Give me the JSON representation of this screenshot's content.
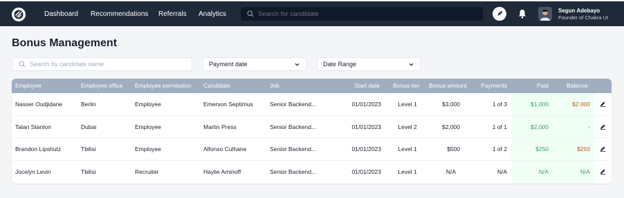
{
  "nav": {
    "items": [
      "Dashboard",
      "Recommendations",
      "Referrals",
      "Analytics"
    ],
    "search_placeholder": "Search for candidate"
  },
  "user": {
    "name": "Segun Adebayo",
    "role": "Founder of Chakra UI"
  },
  "page": {
    "title": "Bonus Management",
    "search_placeholder": "Search by candidate name",
    "filter_payment": "Payment date",
    "filter_range": "Date Range"
  },
  "table": {
    "headers": [
      "Employee",
      "Employee office",
      "Employee permission",
      "Candidate",
      "Job",
      "Start date",
      "Bonus tier",
      "Bonus amount",
      "Payments",
      "Paid",
      "Balance"
    ],
    "rows": [
      [
        "Nasser Oudjidane",
        "Berlin",
        "Employee",
        "Emerson Septimus",
        "Senior Backend...",
        "01/01/2023",
        "Level 1",
        "$3,000",
        "1 of 3",
        "$1,000",
        "$2 000"
      ],
      [
        "Talan Stanton",
        "Dubai",
        "Employee",
        "Martin Press",
        "Senior Backend...",
        "01/01/2023",
        "Level 2",
        "$2,000",
        "1 of 1",
        "$2,000",
        "-"
      ],
      [
        "Brandon Lipshutz",
        "Tbilisi",
        "Employee",
        "Alfonso Culhane",
        "Senior Backend...",
        "01/01/2023",
        "Level 1",
        "$500",
        "1 of 2",
        "$250",
        "$250"
      ],
      [
        "Jocelyn Levin",
        "Tbilisi",
        "Recruiter",
        "Haylie Aminoff",
        "Senior Backend...",
        "01/01/2023",
        "Level 1",
        "N/A",
        "N/A",
        "N/A",
        "N/A"
      ]
    ]
  },
  "colors": {
    "topbar": "#1f2937",
    "header": "#a0aec0",
    "paid_text": "#38a169",
    "balance_text": "#c05621",
    "paid_bg": "#f0fff4"
  },
  "icons": [
    "logo-icon",
    "search-icon",
    "rocket-icon",
    "bell-icon",
    "chevron-down-icon",
    "edit-icon"
  ]
}
